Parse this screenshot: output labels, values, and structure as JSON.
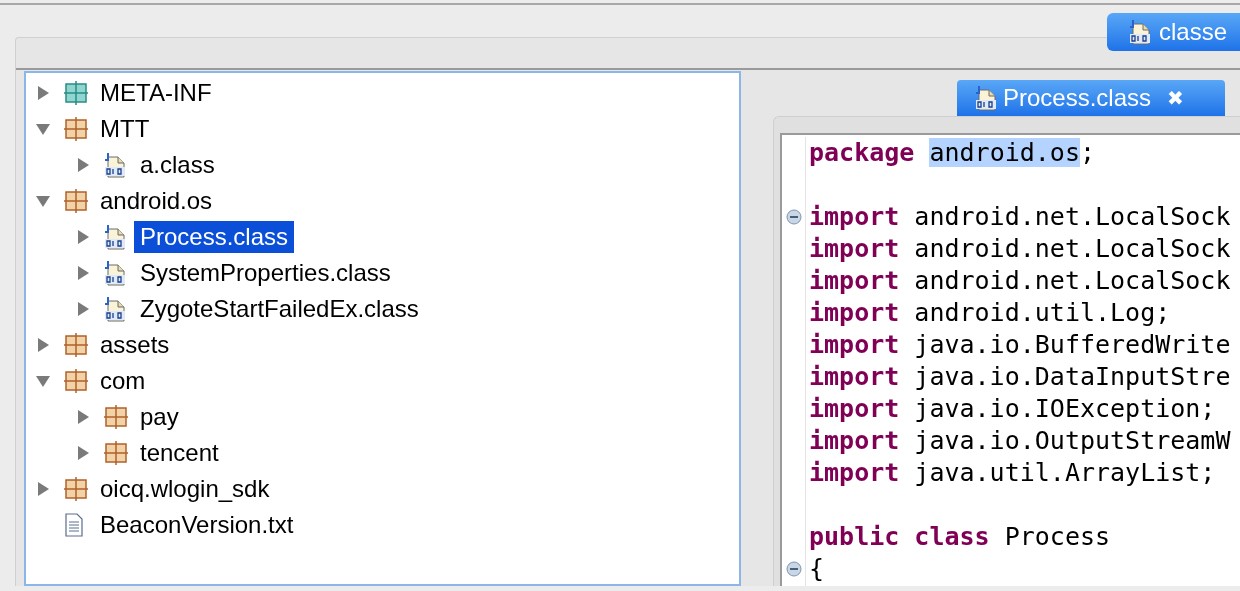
{
  "top_tab": {
    "label": "classe"
  },
  "tree": [
    {
      "label": "META-INF",
      "kind": "meta",
      "expanded": false,
      "selected": false
    },
    {
      "label": "MTT",
      "kind": "package",
      "expanded": true,
      "selected": false,
      "children": [
        {
          "label": "a.class",
          "kind": "class",
          "expanded": false,
          "selected": false
        }
      ]
    },
    {
      "label": "android.os",
      "kind": "package",
      "expanded": true,
      "selected": false,
      "children": [
        {
          "label": "Process.class",
          "kind": "class",
          "expanded": false,
          "selected": true
        },
        {
          "label": "SystemProperties.class",
          "kind": "class",
          "expanded": false,
          "selected": false
        },
        {
          "label": "ZygoteStartFailedEx.class",
          "kind": "class",
          "expanded": false,
          "selected": false
        }
      ]
    },
    {
      "label": "assets",
      "kind": "package",
      "expanded": false,
      "selected": false
    },
    {
      "label": "com",
      "kind": "package",
      "expanded": true,
      "selected": false,
      "children": [
        {
          "label": "pay",
          "kind": "package",
          "expanded": false,
          "selected": false
        },
        {
          "label": "tencent",
          "kind": "package",
          "expanded": false,
          "selected": false
        }
      ]
    },
    {
      "label": "oicq.wlogin_sdk",
      "kind": "package",
      "expanded": false,
      "selected": false
    },
    {
      "label": "BeaconVersion.txt",
      "kind": "text",
      "selected": false
    }
  ],
  "editor": {
    "tab": {
      "label": "Process.class",
      "close": "✖"
    },
    "blocks": [
      {
        "lines": [
          {
            "tokens": [
              {
                "text": "package ",
                "kind": "keyword"
              },
              {
                "text": "android.os",
                "kind": "highlight"
              },
              {
                "text": ";",
                "kind": "plain"
              }
            ]
          }
        ]
      },
      {
        "lines": [
          {
            "fold": true,
            "tokens": [
              {
                "text": "import",
                "kind": "keyword"
              },
              {
                "text": " android.net.LocalSock",
                "kind": "plain"
              }
            ]
          },
          {
            "tokens": [
              {
                "text": "import",
                "kind": "keyword"
              },
              {
                "text": " android.net.LocalSock",
                "kind": "plain"
              }
            ]
          },
          {
            "tokens": [
              {
                "text": "import",
                "kind": "keyword"
              },
              {
                "text": " android.net.LocalSock",
                "kind": "plain"
              }
            ]
          },
          {
            "tokens": [
              {
                "text": "import",
                "kind": "keyword"
              },
              {
                "text": " android.util.Log;",
                "kind": "plain"
              }
            ]
          },
          {
            "tokens": [
              {
                "text": "import",
                "kind": "keyword"
              },
              {
                "text": " java.io.BufferedWrite",
                "kind": "plain"
              }
            ]
          },
          {
            "tokens": [
              {
                "text": "import",
                "kind": "keyword"
              },
              {
                "text": " java.io.DataInputStre",
                "kind": "plain"
              }
            ]
          },
          {
            "tokens": [
              {
                "text": "import",
                "kind": "keyword"
              },
              {
                "text": " java.io.IOException;",
                "kind": "plain"
              }
            ]
          },
          {
            "tokens": [
              {
                "text": "import",
                "kind": "keyword"
              },
              {
                "text": " java.io.OutputStreamW",
                "kind": "plain"
              }
            ]
          },
          {
            "tokens": [
              {
                "text": "import",
                "kind": "keyword"
              },
              {
                "text": " java.util.ArrayList;",
                "kind": "plain"
              }
            ]
          }
        ]
      },
      {
        "lines": [
          {
            "tokens": [
              {
                "text": "public ",
                "kind": "keyword"
              },
              {
                "text": "class",
                "kind": "keyword"
              },
              {
                "text": " Process",
                "kind": "plain"
              }
            ]
          },
          {
            "fold": true,
            "tokens": [
              {
                "text": "{",
                "kind": "plain"
              }
            ]
          }
        ]
      }
    ]
  }
}
